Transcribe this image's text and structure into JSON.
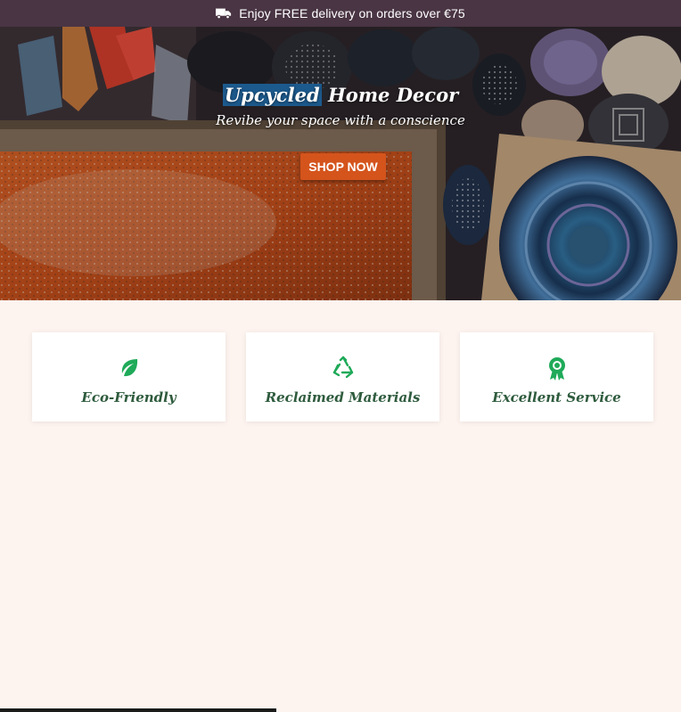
{
  "announcement": {
    "icon": "truck-icon",
    "text": "Enjoy FREE delivery on orders over €75"
  },
  "hero": {
    "title_highlight": "Upcycled",
    "title_rest": " Home Decor",
    "subtitle": "Revibe your space with a conscience",
    "cta_label": "SHOP NOW"
  },
  "features": [
    {
      "icon": "leaf-icon",
      "label": "Eco-Friendly"
    },
    {
      "icon": "recycle-icon",
      "label": "Reclaimed Materials"
    },
    {
      "icon": "award-ribbon-icon",
      "label": "Excellent Service"
    }
  ],
  "colors": {
    "topbar": "#4a3544",
    "cta": "#d4541c",
    "icon_green": "#1faa59",
    "feature_text": "#2e5b3d",
    "section_bg": "#fdf3ef"
  }
}
